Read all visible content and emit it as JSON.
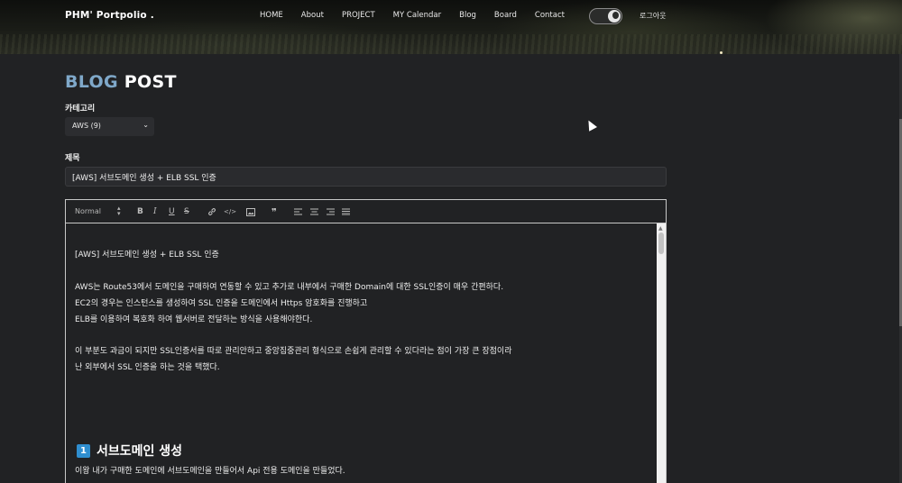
{
  "header": {
    "brand": "PHM' Portpolio .",
    "nav": [
      "HOME",
      "About",
      "PROJECT",
      "MY Calendar",
      "Blog",
      "Board",
      "Contact"
    ],
    "logout": "로그아웃"
  },
  "page": {
    "heading_part1": "BLOG ",
    "heading_part2": "POST",
    "category_label": "카테고리",
    "category_value": "AWS (9)",
    "title_label": "제목",
    "title_value": "[AWS] 서브도메인 생성 + ELB SSL 인증"
  },
  "editor": {
    "format_label": "Normal",
    "toolbar_buttons": [
      "B",
      "I",
      "U",
      "S",
      "link",
      "code",
      "image",
      "quote",
      "align-left",
      "align-center",
      "align-right",
      "justify"
    ],
    "lines": [
      "[AWS] 서브도메인 생성 + ELB SSL 인증",
      "AWS는 Route53에서 도메인을 구매하여 연동할 수 있고 추가로 내부에서 구매한 Domain에 대한 SSL인증이 매우 간편하다.",
      "EC2의 경우는 인스턴스를 생성하여 SSL 인증을 도메인에서 Https 암호화를 진행하고",
      "ELB를 이용하여 복호화 하여 웹서버로 전달하는 방식을 사용해야한다.",
      "이 부분도 과금이 되지만 SSL인증서를 따로 관리안하고 중앙집중관리 형식으로 손쉽게 관리할 수 있다라는 점이 가장 큰 장점이라",
      "난 외부에서 SSL 인증을 하는 것을 택했다."
    ],
    "section_number": "1",
    "section_title": "서브도메인 생성",
    "section_body": "이왕 내가 구매한 도메인에 서브도메인을 만들어서 Api 전용 도메인을 만들었다."
  }
}
